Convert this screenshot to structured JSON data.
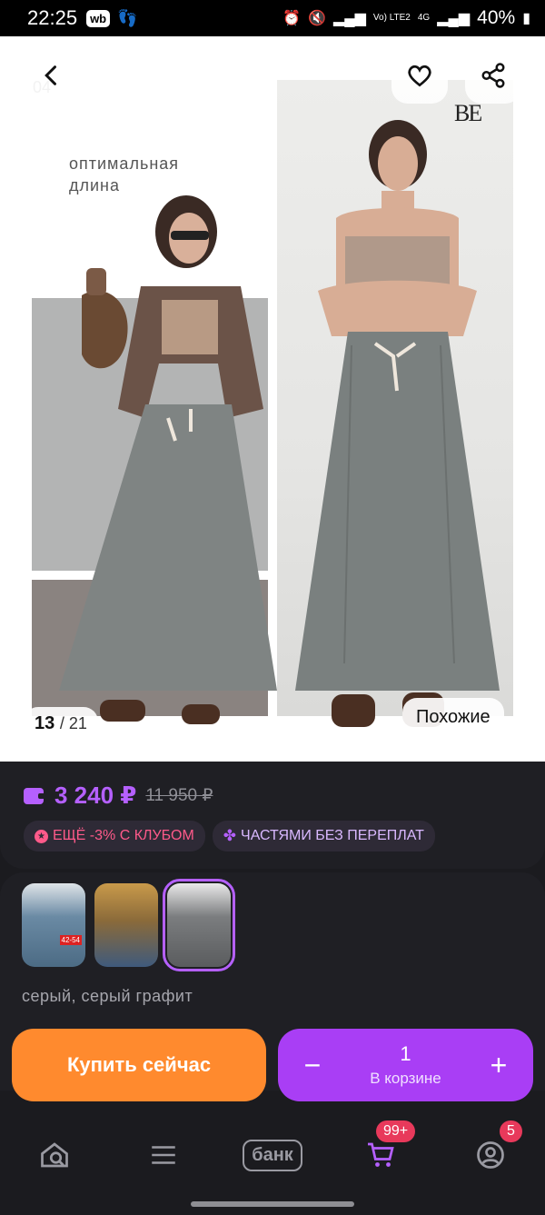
{
  "status_bar": {
    "time": "22:25",
    "app_badge": "wb",
    "network_small": "Vo) LTE2",
    "network_4g": "4G",
    "battery": "40%"
  },
  "gallery": {
    "page_small": "04",
    "caption": "оптимальная длина",
    "brand": "BE",
    "counter_current": "13",
    "counter_total": "/ 21",
    "similar_label": "Похожие"
  },
  "price": {
    "current": "3 240 ₽",
    "old": "11 950 ₽",
    "badge_club": "ЕЩЁ -3% С КЛУБОМ",
    "badge_parts": "ЧАСТЯМИ БЕЗ ПЕРЕПЛАТ"
  },
  "variants": {
    "selected_color": "серый, серый графит",
    "thumb_tag": "42-54"
  },
  "actions": {
    "buy_now": "Купить сейчас",
    "cart_qty": "1",
    "cart_label": "В корзине",
    "minus": "−",
    "plus": "+"
  },
  "nav": {
    "bank": "банк",
    "cart_badge": "99+",
    "profile_badge": "5"
  },
  "colors": {
    "accent": "#b560ff",
    "buy": "#ff8a2e",
    "cart": "#a93ef5",
    "badge": "#e8395b"
  }
}
